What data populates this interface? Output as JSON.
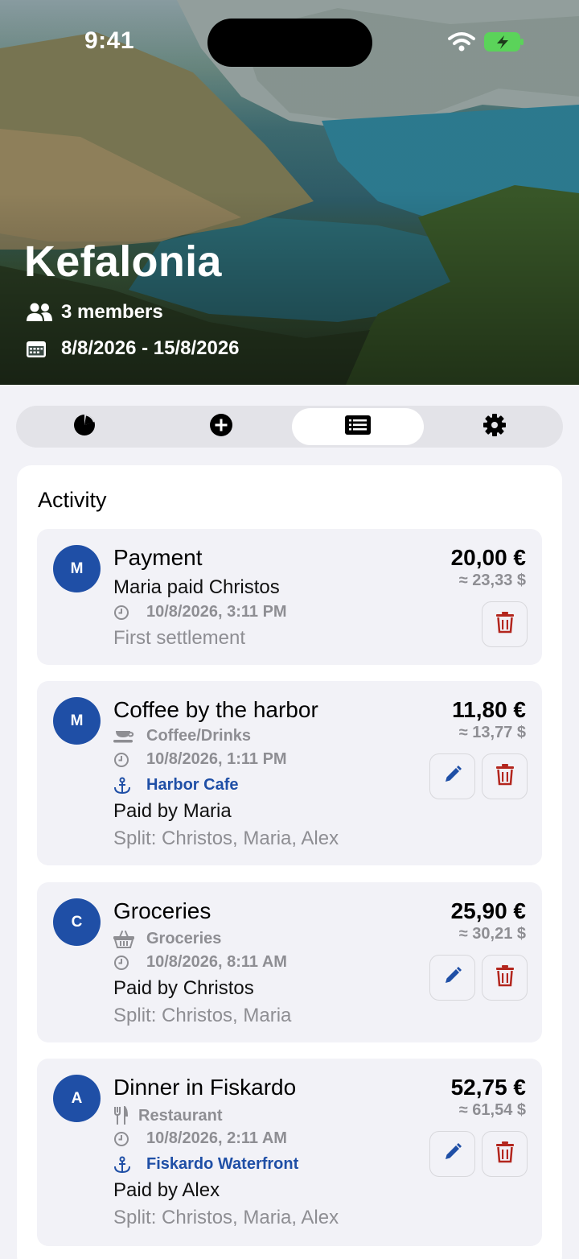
{
  "status_bar": {
    "time": "9:41"
  },
  "trip": {
    "name": "Kefalonia",
    "members_text": "3 members",
    "dates_text": "8/8/2026 - 15/8/2026"
  },
  "tabs": [
    {
      "icon": "pie-chart-icon",
      "active": false
    },
    {
      "icon": "add-circle-icon",
      "active": false
    },
    {
      "icon": "list-icon",
      "active": true
    },
    {
      "icon": "gear-icon",
      "active": false
    }
  ],
  "activity": {
    "title": "Activity",
    "items": [
      {
        "type": "payment",
        "avatar": "M",
        "title": "Payment",
        "subtitle": "Maria paid Christos",
        "datetime": "10/8/2026, 3:11 PM",
        "note": "First settlement",
        "amount": "20,00 €",
        "converted": "≈ 23,33 $"
      },
      {
        "type": "expense",
        "avatar": "M",
        "title": "Coffee by the harbor",
        "category": "Coffee/Drinks",
        "category_icon": "coffee-cup-icon",
        "datetime": "10/8/2026, 1:11 PM",
        "location": "Harbor Cafe",
        "paid_by": "Paid by Maria",
        "split": "Split: Christos, Maria, Alex",
        "amount": "11,80 €",
        "converted": "≈ 13,77 $"
      },
      {
        "type": "expense",
        "avatar": "C",
        "title": "Groceries",
        "category": "Groceries",
        "category_icon": "basket-icon",
        "datetime": "10/8/2026, 8:11 AM",
        "paid_by": "Paid by Christos",
        "split": "Split: Christos, Maria",
        "amount": "25,90 €",
        "converted": "≈ 30,21 $"
      },
      {
        "type": "expense",
        "avatar": "A",
        "title": "Dinner in Fiskardo",
        "category": "Restaurant",
        "category_icon": "fork-knife-icon",
        "datetime": "10/8/2026, 2:11 AM",
        "location": "Fiskardo Waterfront",
        "paid_by": "Paid by Alex",
        "split": "Split: Christos, Maria, Alex",
        "amount": "52,75 €",
        "converted": "≈ 61,54 $"
      }
    ]
  },
  "colors": {
    "accent": "#1f4fa6",
    "delete": "#b3261e",
    "background": "#f2f2f7"
  }
}
